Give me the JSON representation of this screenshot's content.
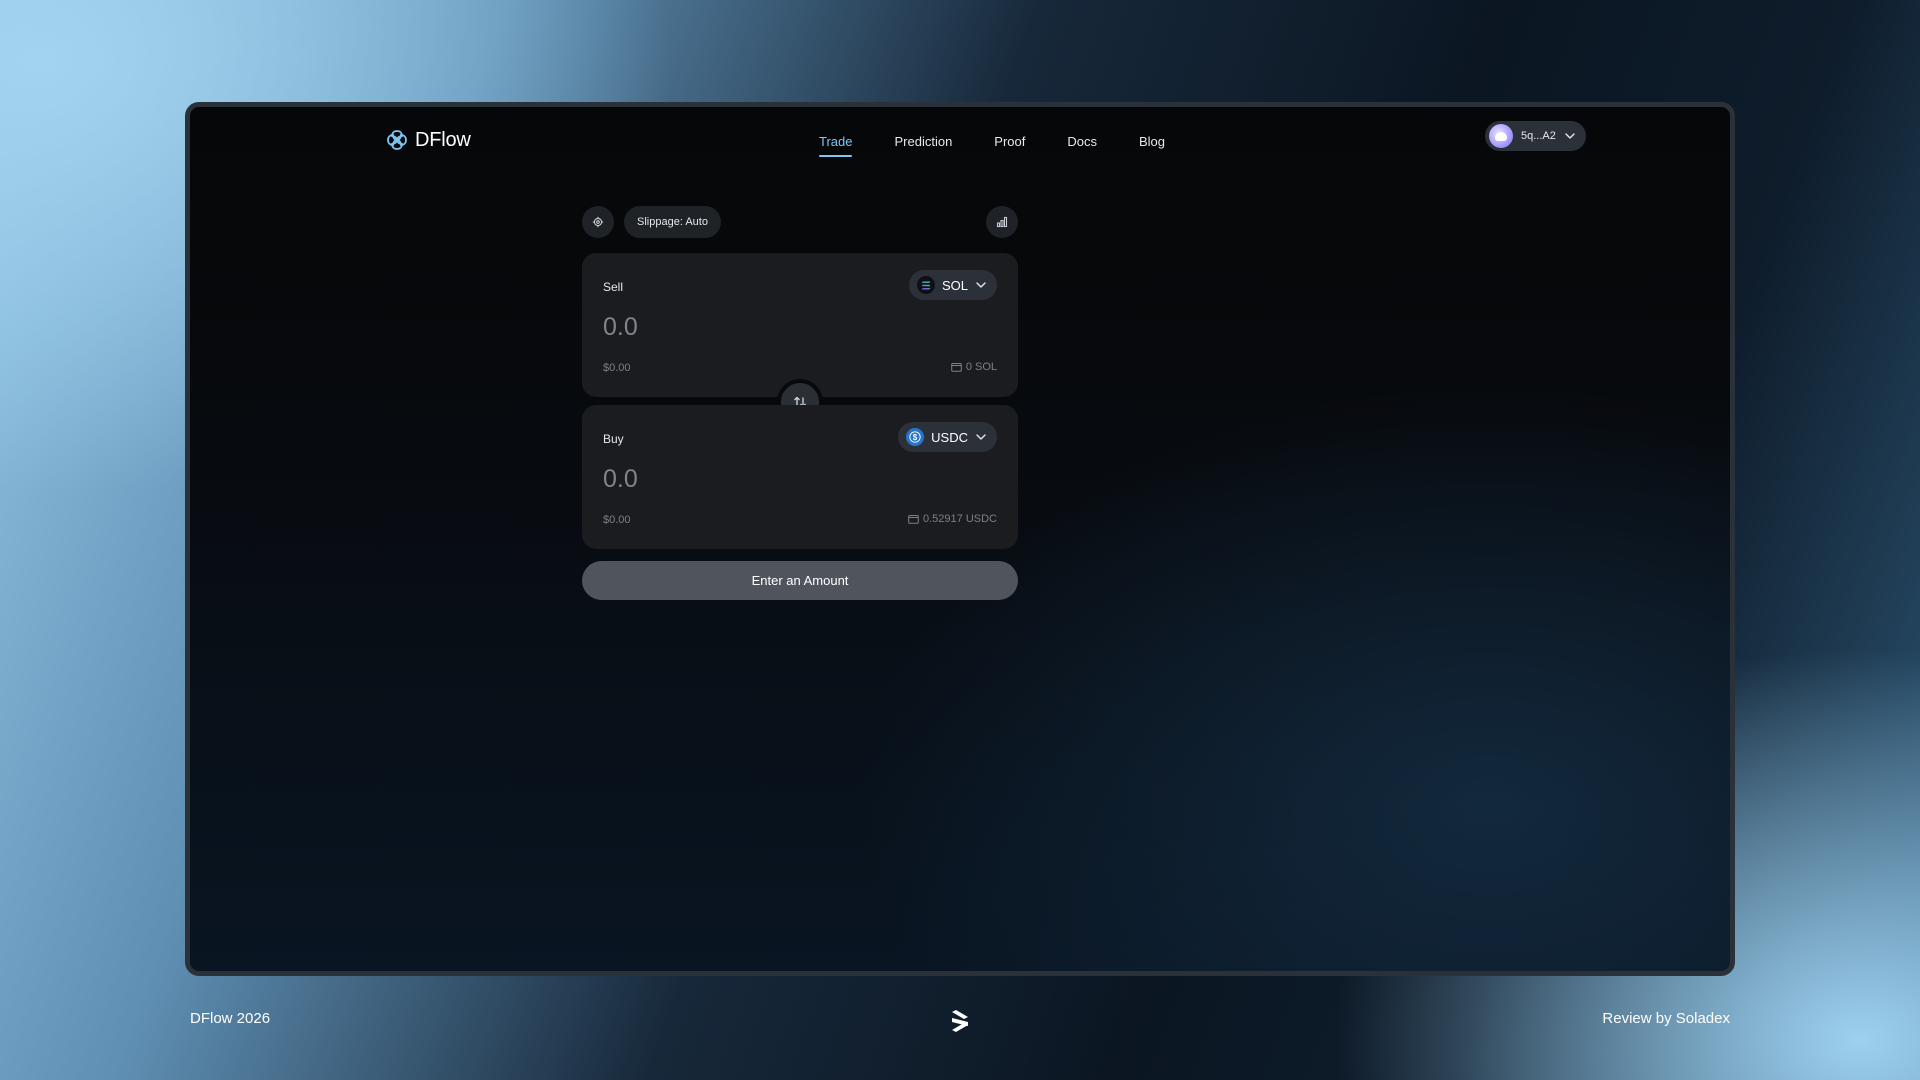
{
  "app": {
    "name": "DFlow"
  },
  "nav": {
    "items": [
      {
        "label": "Trade",
        "active": true
      },
      {
        "label": "Prediction"
      },
      {
        "label": "Proof"
      },
      {
        "label": "Docs"
      },
      {
        "label": "Blog"
      }
    ]
  },
  "wallet": {
    "address": "5q...A2"
  },
  "toolbar": {
    "slippage_label": "Slippage: Auto"
  },
  "sell": {
    "label": "Sell",
    "token": "SOL",
    "amount_placeholder": "0.0",
    "usd_value": "$0.00",
    "balance": "0 SOL"
  },
  "buy": {
    "label": "Buy",
    "token": "USDC",
    "amount_placeholder": "0.0",
    "usd_value": "$0.00",
    "balance": "0.52917 USDC"
  },
  "cta": {
    "label": "Enter an Amount"
  },
  "footer": {
    "left": "DFlow 2026",
    "right": "Review by Soladex"
  },
  "colors": {
    "accent": "#7ec6f3",
    "card": "#1a1c20",
    "pill": "#2c3038",
    "cta": "#50545c",
    "usdc": "#2775ca"
  }
}
